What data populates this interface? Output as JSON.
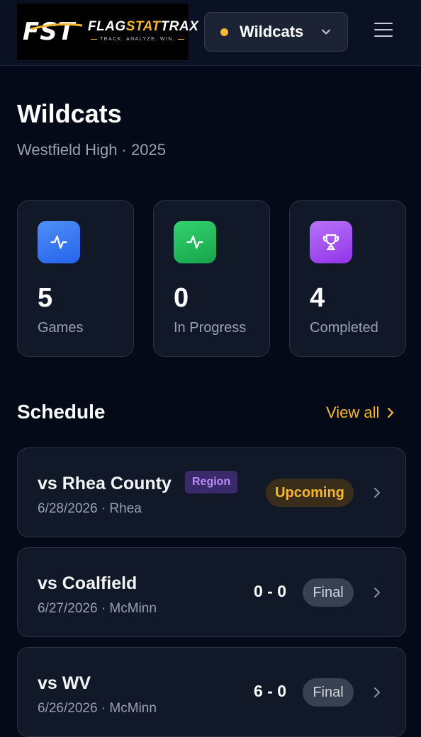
{
  "header": {
    "logo": {
      "mark": "FST",
      "name_part1": "FLAG",
      "name_part2": "STAT",
      "name_part3": "TRAX",
      "tagline": "TRACK. ANALYZE. WIN."
    },
    "team_selector": {
      "value": "Wildcats",
      "status_color": "#f5b82e"
    },
    "menu_icon": "hamburger-menu-icon"
  },
  "team": {
    "name": "Wildcats",
    "subtitle": "Westfield High · 2025"
  },
  "stats": [
    {
      "value": "5",
      "label": "Games",
      "icon": "activity-icon",
      "color": "#3b82f6"
    },
    {
      "value": "0",
      "label": "In Progress",
      "icon": "activity-icon",
      "color": "#22c55e"
    },
    {
      "value": "4",
      "label": "Completed",
      "icon": "trophy-icon",
      "color": "#a855f7"
    }
  ],
  "schedule": {
    "title": "Schedule",
    "view_all": "View all",
    "games": [
      {
        "opponent": "vs Rhea County",
        "tag": "Region",
        "date": "6/28/2026",
        "location": "Rhea",
        "status": "Upcoming",
        "score": ""
      },
      {
        "opponent": "vs Coalfield",
        "tag": "",
        "date": "6/27/2026",
        "location": "McMinn",
        "status": "Final",
        "score": "0 - 0"
      },
      {
        "opponent": "vs WV",
        "tag": "",
        "date": "6/26/2026",
        "location": "McMinn",
        "status": "Final",
        "score": "6 - 0"
      }
    ]
  },
  "colors": {
    "accent": "#f5b82e",
    "background": "#050a18",
    "card": "#111827"
  }
}
